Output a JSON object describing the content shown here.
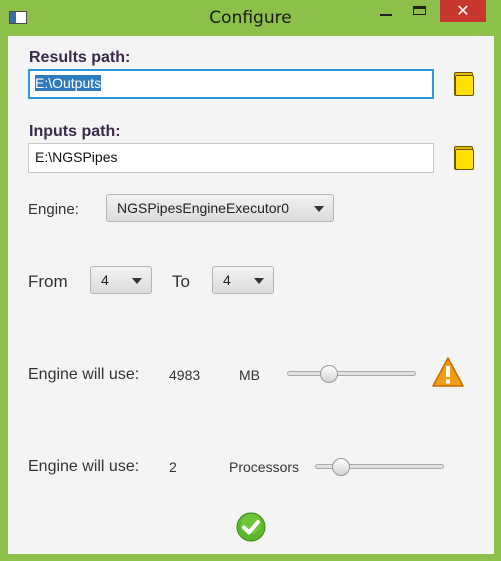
{
  "window": {
    "title": "Configure",
    "close_glyph": "✕"
  },
  "results": {
    "label": "Results path:",
    "value": "E:\\Outputs"
  },
  "inputs": {
    "label": "Inputs path:",
    "value": "E:\\NGSPipes"
  },
  "engine": {
    "label": "Engine:",
    "selected": "NGSPipesEngineExecutor0"
  },
  "range": {
    "from_label": "From",
    "from_value": "4",
    "to_label": "To",
    "to_value": "4"
  },
  "memory": {
    "label": "Engine will use:",
    "value": "4983",
    "unit": "MB",
    "slider_fraction": 0.3
  },
  "processors": {
    "label": "Engine will use:",
    "value": "2",
    "unit": "Processors",
    "slider_fraction": 0.15
  },
  "icons": {
    "browse_results": "folder-icon",
    "browse_inputs": "folder-icon",
    "warning": "warning-icon",
    "confirm": "checkmark-icon"
  },
  "colors": {
    "accent": "#2c9ad9",
    "window_frame": "#8cc04a",
    "close_button": "#c7372f",
    "warning": "#f39c12",
    "confirm": "#5cb82a"
  }
}
